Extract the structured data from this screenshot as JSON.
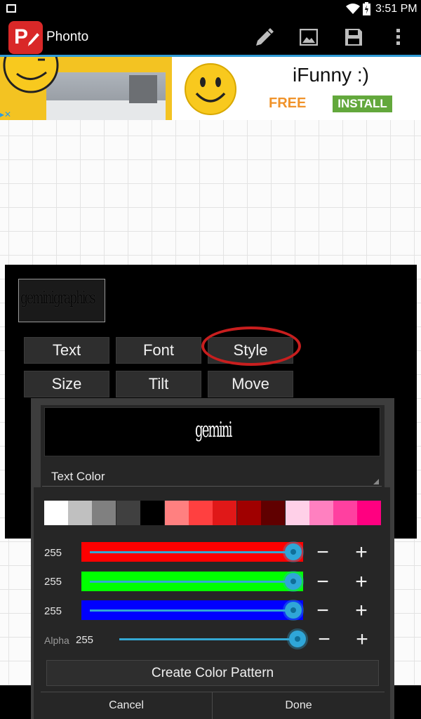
{
  "status_bar": {
    "time": "3:51 PM"
  },
  "action_bar": {
    "app_name": "Phonto",
    "logo_letter": "P"
  },
  "ad": {
    "title": "iFunny :)",
    "free_label": "FREE",
    "install_label": "INSTALL"
  },
  "preview_text": "geminigraphics",
  "menu": {
    "text": "Text",
    "font": "Font",
    "style": "Style",
    "size": "Size",
    "tilt": "Tilt",
    "move": "Move"
  },
  "dialog": {
    "preview_text": "gemini",
    "section_label": "Text Color",
    "swatches": [
      "#ffffff",
      "#c0c0c0",
      "#808080",
      "#404040",
      "#000000",
      "#ff8080",
      "#ff4040",
      "#e01818",
      "#a00000",
      "#600000",
      "#ffd0e8",
      "#ff80c0",
      "#ff40a0",
      "#ff0080"
    ],
    "red": {
      "value": "255"
    },
    "green": {
      "value": "255"
    },
    "blue": {
      "value": "255"
    },
    "alpha": {
      "label": "Alpha",
      "value": "255"
    },
    "create_pattern_label": "Create Color Pattern",
    "cancel_label": "Cancel",
    "done_label": "Done"
  },
  "colors": {
    "accent": "#2f9bd6",
    "highlight_circle": "#c81e1e"
  }
}
